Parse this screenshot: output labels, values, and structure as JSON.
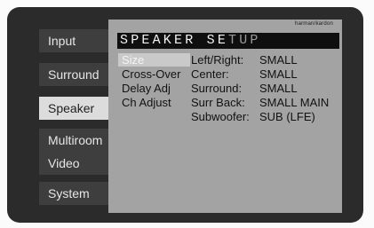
{
  "tabs": [
    {
      "label": "Input"
    },
    {
      "label": "Surround"
    },
    {
      "label": "Speaker",
      "active": true
    },
    {
      "label": "Multiroom"
    },
    {
      "label": "Video"
    },
    {
      "label": "System"
    }
  ],
  "panel": {
    "brand": "harman/kardon",
    "title_a": "SPEAKER SE",
    "title_b": "TUP",
    "menu": [
      {
        "label": "Size",
        "selected": true
      },
      {
        "label": "Cross-Over"
      },
      {
        "label": "Delay Adj"
      },
      {
        "label": "Ch Adjust"
      }
    ],
    "settings": [
      {
        "label": "Left/Right:",
        "value": "SMALL"
      },
      {
        "label": "Center:",
        "value": "SMALL"
      },
      {
        "label": "Surround:",
        "value": "SMALL"
      },
      {
        "label": "Surr Back:",
        "value": "SMALL MAIN"
      },
      {
        "label": "Subwoofer:",
        "value": "SUB (LFE)"
      }
    ]
  },
  "colors": {
    "screen_bg": "#2b2b2b",
    "panel_bg": "#a3a3a3",
    "tab_bg": "#3e3e3e",
    "tab_active_bg": "#dcdcdc",
    "title_bar": "#0f0f0f",
    "selected_item_bg": "#c9c9c9"
  }
}
